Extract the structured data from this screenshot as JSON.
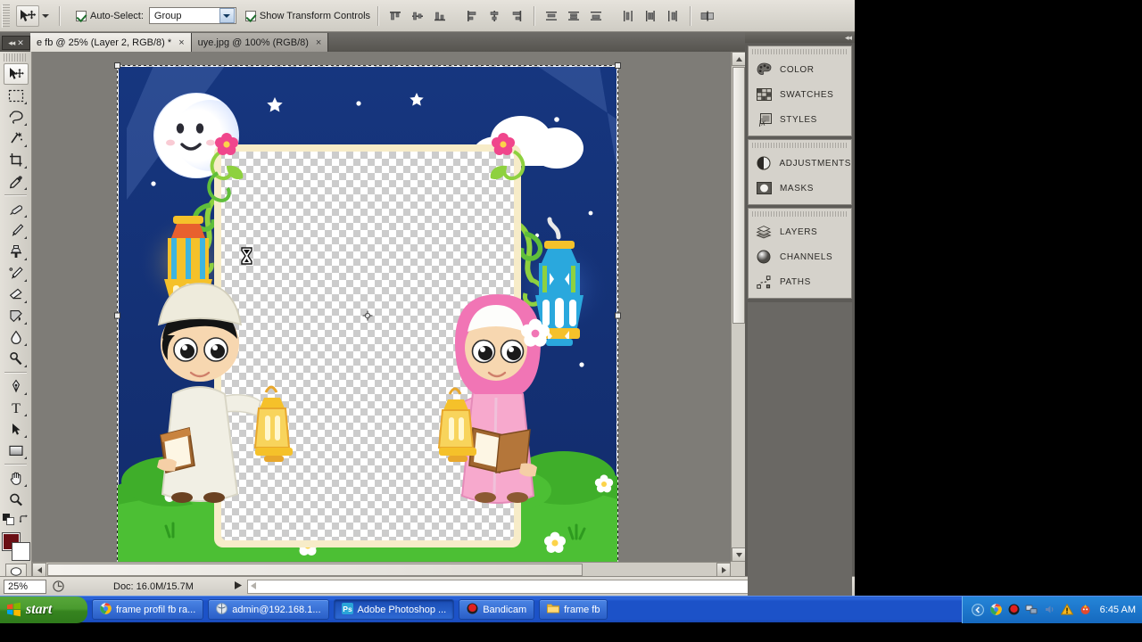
{
  "options_bar": {
    "tool_icon": "move-tool-icon",
    "auto_select_checked": true,
    "auto_select_label": "Auto-Select:",
    "auto_select_value": "Group",
    "show_transform_checked": true,
    "show_transform_label": "Show Transform Controls",
    "align_buttons": [
      "align-top-edges",
      "align-vertical-centers",
      "align-bottom-edges",
      "align-left-edges",
      "align-horizontal-centers",
      "align-right-edges"
    ],
    "distribute_buttons": [
      "distribute-top-edges",
      "distribute-vertical-centers",
      "distribute-bottom-edges",
      "distribute-left-edges",
      "distribute-horizontal-centers",
      "distribute-right-edges"
    ],
    "last_button": "auto-align-layers"
  },
  "tabs": [
    {
      "title": "e fb @ 25% (Layer 2, RGB/8) *",
      "active": true,
      "close": "×"
    },
    {
      "title": "uye.jpg @ 100% (RGB/8)",
      "active": false,
      "close": "×"
    }
  ],
  "tools": [
    {
      "name": "move-tool",
      "selected": true,
      "has_flyout": false
    },
    {
      "name": "rectangular-marquee-tool",
      "selected": false,
      "has_flyout": true
    },
    {
      "name": "lasso-tool",
      "selected": false,
      "has_flyout": true
    },
    {
      "name": "magic-wand-tool",
      "selected": false,
      "has_flyout": true
    },
    {
      "name": "crop-tool",
      "selected": false,
      "has_flyout": true
    },
    {
      "name": "eyedropper-tool",
      "selected": false,
      "has_flyout": true
    },
    {
      "name": "healing-brush-tool",
      "selected": false,
      "has_flyout": true
    },
    {
      "name": "brush-tool",
      "selected": false,
      "has_flyout": true
    },
    {
      "name": "clone-stamp-tool",
      "selected": false,
      "has_flyout": true
    },
    {
      "name": "history-brush-tool",
      "selected": false,
      "has_flyout": true
    },
    {
      "name": "eraser-tool",
      "selected": false,
      "has_flyout": true
    },
    {
      "name": "gradient-tool",
      "selected": false,
      "has_flyout": true
    },
    {
      "name": "blur-tool",
      "selected": false,
      "has_flyout": true
    },
    {
      "name": "dodge-tool",
      "selected": false,
      "has_flyout": true
    },
    {
      "name": "pen-tool",
      "selected": false,
      "has_flyout": true
    },
    {
      "name": "horizontal-type-tool",
      "selected": false,
      "has_flyout": true
    },
    {
      "name": "path-selection-tool",
      "selected": false,
      "has_flyout": true
    },
    {
      "name": "rectangle-shape-tool",
      "selected": false,
      "has_flyout": true
    },
    {
      "name": "hand-tool",
      "selected": false,
      "has_flyout": true
    },
    {
      "name": "zoom-tool",
      "selected": false,
      "has_flyout": false
    }
  ],
  "color_swatches": {
    "foreground": "#6b0f15",
    "background": "#ffffff",
    "swap_icon": "swap-colors-icon",
    "default_icon": "default-colors-icon",
    "quick_mask": "quick-mask-mode-icon"
  },
  "status_bar": {
    "zoom_value": "25%",
    "zoom_icon": "preview-icon",
    "doc_info": "Doc: 16.0M/15.7M",
    "arrow_icon": "status-flyout-arrow"
  },
  "right_dock": {
    "collapse_icon": "collapse-panels-icon",
    "groups": [
      {
        "items": [
          {
            "label": "COLOR",
            "icon": "color-palette-icon"
          },
          {
            "label": "SWATCHES",
            "icon": "swatches-grid-icon"
          },
          {
            "label": "STYLES",
            "icon": "styles-fx-icon"
          }
        ]
      },
      {
        "items": [
          {
            "label": "ADJUSTMENTS",
            "icon": "adjustments-halfcircle-icon"
          },
          {
            "label": "MASKS",
            "icon": "masks-circle-icon"
          }
        ]
      },
      {
        "items": [
          {
            "label": "LAYERS",
            "icon": "layers-stack-icon"
          },
          {
            "label": "CHANNELS",
            "icon": "channels-sphere-icon"
          },
          {
            "label": "PATHS",
            "icon": "paths-anchor-icon"
          }
        ]
      }
    ]
  },
  "canvas": {
    "description": "Ramadan greeting frame artwork on transparent layer",
    "sky_color": "#15357e",
    "grass_color": "#4cbf34",
    "frame_border_color": "#f7ecc8",
    "moon_color": "#ffffff",
    "cloud_color": "#ffffff",
    "left_lantern_colors": [
      "#f5c12a",
      "#e8602e",
      "#3db5e0"
    ],
    "right_lantern_colors": [
      "#2aa8dd",
      "#f5c12a",
      "#8ed13f"
    ],
    "boy": {
      "robe_color": "#f1efe4",
      "cap_color": "#e8e5d6",
      "hair_color": "#1a1a1a",
      "book_color": "#a0662f"
    },
    "girl": {
      "robe_color": "#f7a9cd",
      "hijab_color": "#f175b5",
      "book_color": "#a0662f"
    },
    "cursor": "hourglass-busy-cursor",
    "center_point": "transform-center-point"
  },
  "taskbar": {
    "start_label": "start",
    "tasks": [
      {
        "label": "frame profil fb ra...",
        "icon": "chrome-icon",
        "active": false
      },
      {
        "label": "admin@192.168.1...",
        "icon": "putty-icon",
        "active": false
      },
      {
        "label": "Adobe Photoshop ...",
        "icon": "photoshop-icon",
        "active": true
      },
      {
        "label": "Bandicam",
        "icon": "bandicam-icon",
        "active": false
      },
      {
        "label": "frame fb",
        "icon": "folder-icon",
        "active": false
      }
    ],
    "tray_icons": [
      "show-hidden-icons",
      "chrome-tray-icon",
      "bandicam-tray-icon",
      "network-tray-icon",
      "volume-tray-icon",
      "warning-tray-icon",
      "antivirus-tray-icon"
    ],
    "clock": "6:45 AM"
  }
}
